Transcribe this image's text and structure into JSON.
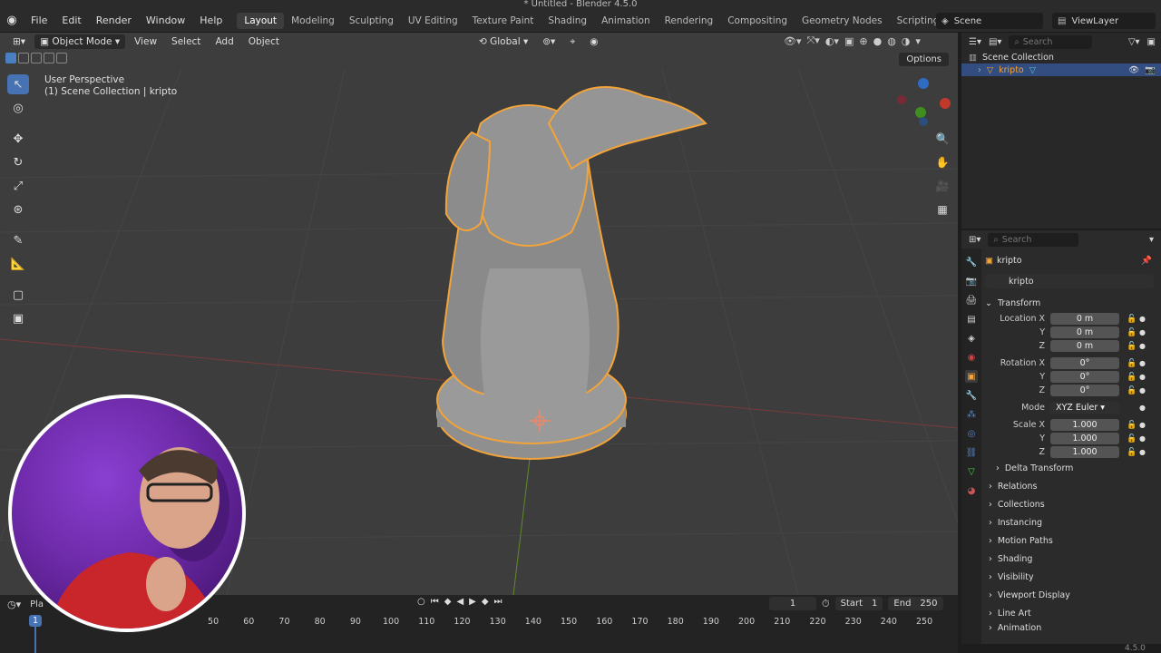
{
  "window": {
    "title": "* Untitled - Blender 4.5.0"
  },
  "menu": {
    "items": [
      "File",
      "Edit",
      "Render",
      "Window",
      "Help"
    ]
  },
  "workspaces": {
    "tabs": [
      "Layout",
      "Modeling",
      "Sculpting",
      "UV Editing",
      "Texture Paint",
      "Shading",
      "Animation",
      "Rendering",
      "Compositing",
      "Geometry Nodes",
      "Scripting"
    ],
    "active": "Layout"
  },
  "scene": {
    "name": "Scene",
    "view_layer": "ViewLayer"
  },
  "viewport": {
    "mode": "Object Mode",
    "menus": [
      "View",
      "Select",
      "Add",
      "Object"
    ],
    "orientation": "Global",
    "info_line1": "User Perspective",
    "info_line2": "(1) Scene Collection | kripto",
    "options_label": "Options"
  },
  "outliner": {
    "search_placeholder": "Search",
    "collection": "Scene Collection",
    "object": "kripto"
  },
  "properties": {
    "search_placeholder": "Search",
    "object_name": "kripto",
    "object_field": "kripto",
    "transform_title": "Transform",
    "location": {
      "label": "Location X",
      "x": "0 m",
      "y": "0 m",
      "z": "0 m"
    },
    "rotation": {
      "label": "Rotation X",
      "x": "0°",
      "y": "0°",
      "z": "0°"
    },
    "mode": {
      "label": "Mode",
      "value": "XYZ Euler"
    },
    "scale": {
      "label": "Scale X",
      "x": "1.000",
      "y": "1.000",
      "z": "1.000"
    },
    "axis_y": "Y",
    "axis_z": "Z",
    "delta_transform": "Delta Transform",
    "sections": [
      "Relations",
      "Collections",
      "Instancing",
      "Motion Paths",
      "Shading",
      "Visibility",
      "Viewport Display",
      "Line Art",
      "Animation"
    ]
  },
  "timeline": {
    "playback_label": "Pla",
    "current_frame": "1",
    "start_label": "Start",
    "start": "1",
    "end_label": "End",
    "end": "250",
    "marker": "1",
    "ticks": [
      "50",
      "60",
      "70",
      "80",
      "90",
      "100",
      "110",
      "120",
      "130",
      "140",
      "150",
      "160",
      "170",
      "180",
      "190",
      "200",
      "210",
      "220",
      "230",
      "240",
      "250"
    ]
  },
  "version": "4.5.0",
  "colors": {
    "accent": "#4772b3",
    "selection_outline": "#f2a33a",
    "viewport_bg": "#3d3d3d"
  }
}
